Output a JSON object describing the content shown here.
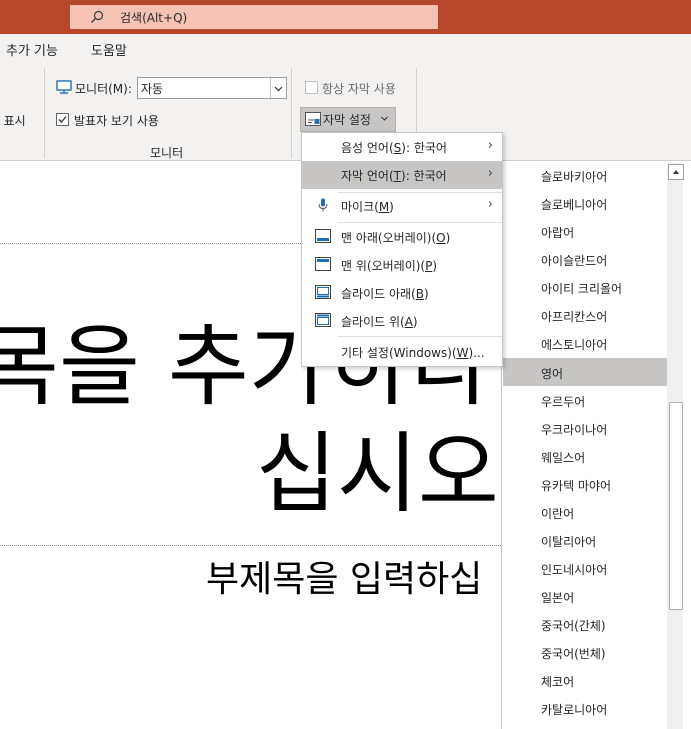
{
  "search": {
    "placeholder": "검색(Alt+Q)"
  },
  "menu_tabs": [
    {
      "label": "추가 기능"
    },
    {
      "label": "도움말"
    }
  ],
  "ribbon": {
    "partial_label": "표시",
    "monitor_label": "모니터(M):",
    "monitor_value": "자동",
    "presenter_view_label": "발표자 보기 사용",
    "group_label": "모니터",
    "always_subtitles_label": "항상 자막 사용",
    "caption_settings_label": "자막 설정"
  },
  "caption_menu": {
    "items": [
      {
        "pre": "음성 언어(",
        "key": "S",
        "post": "): 한국어",
        "submenu": true,
        "icon": "",
        "highlighted": false
      },
      {
        "pre": "자막 언어(",
        "key": "T",
        "post": "): 한국어",
        "submenu": true,
        "icon": "",
        "highlighted": true
      },
      {
        "pre": "마이크(",
        "key": "M",
        "post": ")",
        "submenu": true,
        "icon": "microphone-icon",
        "highlighted": false
      },
      {
        "pre": "맨 아래(오버레이)(",
        "key": "O",
        "post": ")",
        "submenu": false,
        "icon": "overlay-bottom-icon",
        "highlighted": false
      },
      {
        "pre": "맨 위(오버레이)(",
        "key": "P",
        "post": ")",
        "submenu": false,
        "icon": "overlay-top-icon",
        "highlighted": false
      },
      {
        "pre": "슬라이드 아래(",
        "key": "B",
        "post": ")",
        "submenu": false,
        "icon": "below-slide-icon",
        "highlighted": false
      },
      {
        "pre": "슬라이드 위(",
        "key": "A",
        "post": ")",
        "submenu": false,
        "icon": "above-slide-icon",
        "highlighted": false
      },
      {
        "pre": "기타 설정(Windows)(",
        "key": "W",
        "post": ")...",
        "submenu": false,
        "icon": "",
        "highlighted": false
      }
    ]
  },
  "language_list": {
    "selected": "영어",
    "items": [
      "슬로바키아어",
      "슬로베니아어",
      "아랍어",
      "아이슬란드어",
      "아이티 크리올어",
      "아프리칸스어",
      "에스토니아어",
      "영어",
      "우르두어",
      "우크라이나어",
      "웨일스어",
      "유카텍 마야어",
      "이란어",
      "이탈리아어",
      "인도네시아어",
      "일본어",
      "중국어(간체)",
      "중국어(번체)",
      "체코어",
      "카탈로니아어"
    ]
  },
  "slide": {
    "title_line1": "목을 추가하다",
    "title_line2": "십시오",
    "subtitle": "부제목을 입력하십"
  },
  "colors": {
    "titlebar": "#b7472a",
    "search_box": "#f4c3b4",
    "ribbon_bg": "#f3f2f1",
    "menu_highlight": "#c8c6c4",
    "icon_blue": "#1f6fb5"
  }
}
